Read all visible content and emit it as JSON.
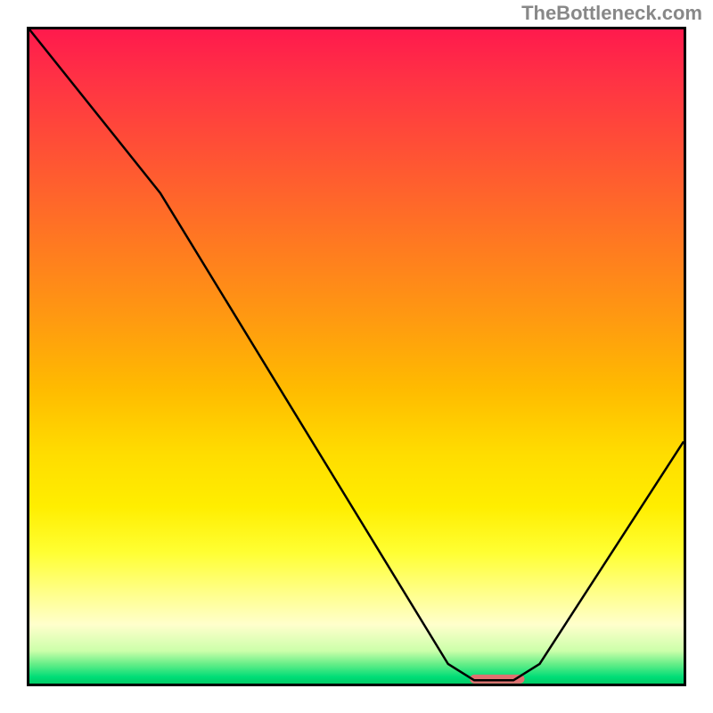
{
  "watermark": "TheBottleneck.com",
  "chart_data": {
    "type": "line",
    "title": "",
    "xlabel": "",
    "ylabel": "",
    "xlim": [
      0,
      100
    ],
    "ylim": [
      0,
      100
    ],
    "curve_points": [
      {
        "x": 0,
        "y": 100
      },
      {
        "x": 20,
        "y": 75
      },
      {
        "x": 64,
        "y": 3
      },
      {
        "x": 68,
        "y": 0.5
      },
      {
        "x": 74,
        "y": 0.5
      },
      {
        "x": 78,
        "y": 3
      },
      {
        "x": 100,
        "y": 37
      }
    ],
    "optimal_zone": {
      "x_start": 68,
      "x_end": 75,
      "y": 0.7
    },
    "gradient_stops": [
      {
        "pos": 0,
        "color": "#ff1a4d"
      },
      {
        "pos": 50,
        "color": "#ffaa00"
      },
      {
        "pos": 80,
        "color": "#ffff33"
      },
      {
        "pos": 100,
        "color": "#00cc66"
      }
    ]
  }
}
